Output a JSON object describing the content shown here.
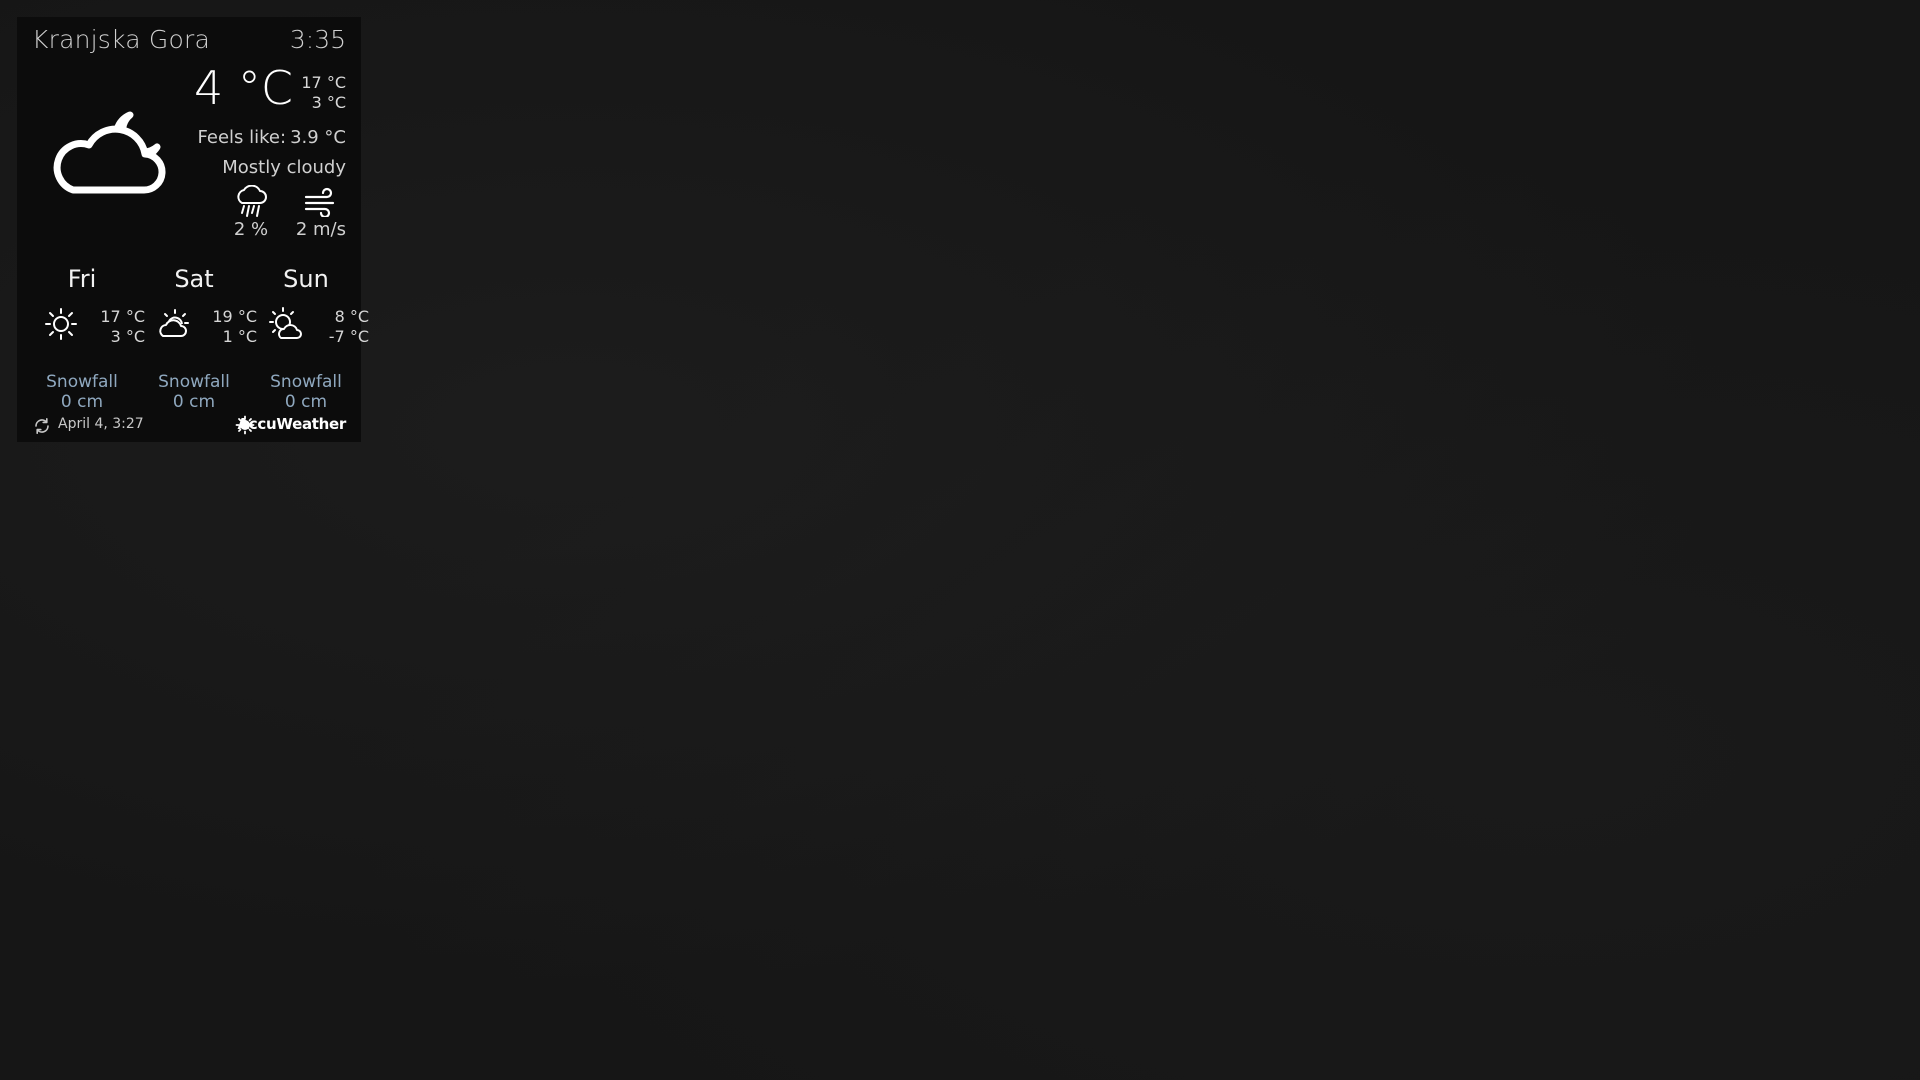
{
  "widget": {
    "location": "Kranjska Gora",
    "time": "3:35",
    "current": {
      "icon": "cloud-moon-icon",
      "temperature": "4 °C",
      "high": "17 °C",
      "low": "3 °C",
      "feels_like_label": "Feels like:",
      "feels_like_value": "3.9 °C",
      "condition": "Mostly cloudy",
      "precipitation_icon": "rain-cloud-icon",
      "precipitation": "2 %",
      "wind_icon": "wind-icon",
      "wind": "2 m/s"
    },
    "forecast": [
      {
        "day": "Fri",
        "icon": "sun-icon",
        "high": "17 °C",
        "low": "3 °C",
        "snow_label": "Snowfall",
        "snow_value": "0 cm"
      },
      {
        "day": "Sat",
        "icon": "partly-cloudy-icon",
        "high": "19 °C",
        "low": "1 °C",
        "snow_label": "Snowfall",
        "snow_value": "0 cm"
      },
      {
        "day": "Sun",
        "icon": "partly-sunny-icon",
        "high": "8 °C",
        "low": "-7 °C",
        "snow_label": "Snowfall",
        "snow_value": "0 cm"
      }
    ],
    "footer": {
      "refresh_icon": "refresh-icon",
      "updated": "April  4, 3:27",
      "brand_icon": "accuweather-sun-icon",
      "brand": "AccuWeather"
    }
  },
  "colors": {
    "background": "#171717",
    "widget_background": "#0c0c0c",
    "text": "#d0d0d0",
    "snowfall": "#8fa8bf"
  }
}
